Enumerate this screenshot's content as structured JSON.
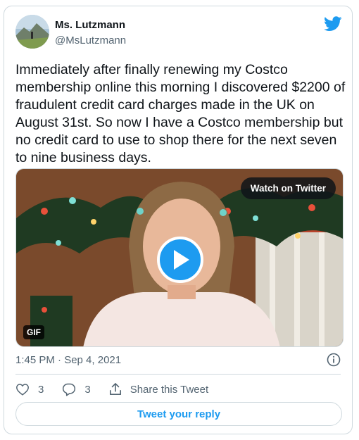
{
  "tweet": {
    "author_name": "Ms. Lutzmann",
    "author_handle": "@MsLutzmann",
    "text": "Immediately after finally renewing my Costco membership online this morning I discovered $2200 of fraudulent credit card charges made in the UK on August 31st.  So now I have a Costco membership but no credit card to use to shop there for the next seven to nine business days.",
    "timestamp": "1:45 PM · Sep 4, 2021"
  },
  "media": {
    "watch_label": "Watch on Twitter",
    "badge": "GIF"
  },
  "actions": {
    "like_count": "3",
    "reply_count": "3",
    "share_label": "Share this Tweet"
  },
  "reply_button_label": "Tweet your reply",
  "colors": {
    "accent": "#1d9bf0",
    "text": "#0f1419",
    "muted": "#536471",
    "border": "#cfd9de"
  },
  "icons": [
    "twitter-bird-icon",
    "play-icon",
    "info-icon",
    "heart-icon",
    "reply-icon",
    "share-icon"
  ]
}
